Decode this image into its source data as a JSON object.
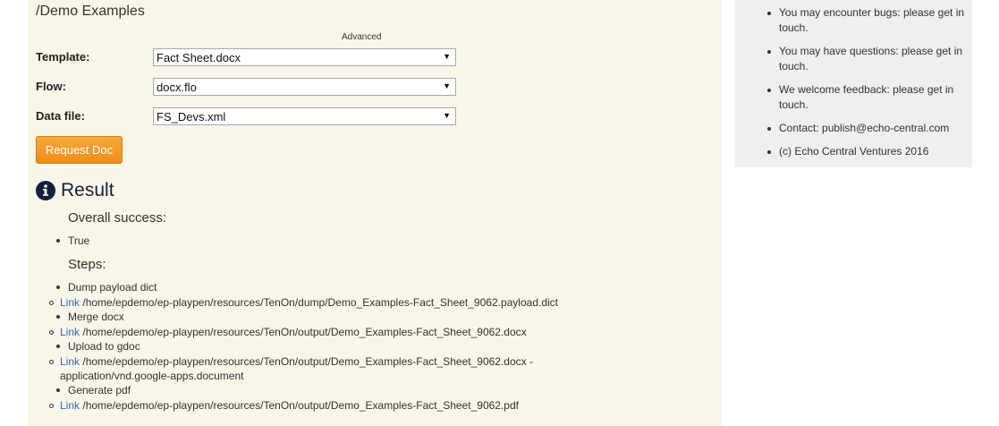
{
  "page": {
    "title": "/Demo Examples",
    "advanced_label": "Advanced"
  },
  "form": {
    "template": {
      "label": "Template:",
      "value": "Fact Sheet.docx"
    },
    "flow": {
      "label": "Flow:",
      "value": "docx.flo"
    },
    "data_file": {
      "label": "Data file:",
      "value": "FS_Devs.xml"
    },
    "submit_label": "Request Doc"
  },
  "result": {
    "title": "Result",
    "overall_heading": "Overall success:",
    "overall_value": "True",
    "steps_heading": "Steps:",
    "steps": [
      {
        "name": "Dump payload dict",
        "link_label": "Link",
        "path": "/home/epdemo/ep-playpen/resources/TenOn/dump/Demo_Examples-Fact_Sheet_9062.payload.dict"
      },
      {
        "name": "Merge docx",
        "link_label": "Link",
        "path": "/home/epdemo/ep-playpen/resources/TenOn/output/Demo_Examples-Fact_Sheet_9062.docx"
      },
      {
        "name": "Upload to gdoc",
        "link_label": "Link",
        "path": "/home/epdemo/ep-playpen/resources/TenOn/output/Demo_Examples-Fact_Sheet_9062.docx - application/vnd.google-apps.document"
      },
      {
        "name": "Generate pdf",
        "link_label": "Link",
        "path": "/home/epdemo/ep-playpen/resources/TenOn/output/Demo_Examples-Fact_Sheet_9062.pdf"
      }
    ]
  },
  "sidebar": {
    "notices": [
      "You may encounter bugs: please get in touch.",
      "You may have questions: please get in touch.",
      "We welcome feedback: please get in touch.",
      "Contact: publish@echo-central.com",
      "(c) Echo Central Ventures 2016"
    ]
  },
  "icons": {
    "result_icon": "info-circle-icon",
    "select_arrow": "caret-down-icon"
  },
  "colors": {
    "panel_bg": "#f8f5e9",
    "sidebar_bg": "#efefef",
    "button_orange": "#f0961f",
    "result_title": "#14213d",
    "link": "#2a6ebb"
  }
}
